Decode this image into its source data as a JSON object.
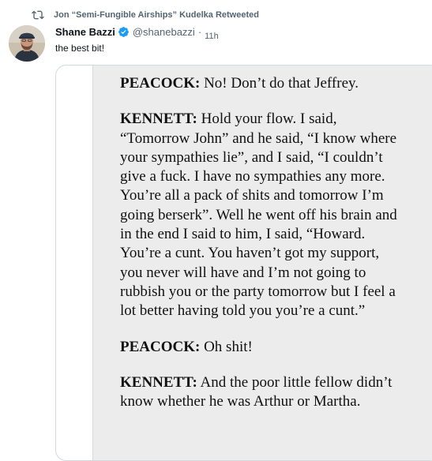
{
  "retweet": {
    "icon": "retweet-icon",
    "text": "Jon “Semi-Fungible Airships” Kudelka Retweeted"
  },
  "author": {
    "name": "Shane Bazzi",
    "verified_icon": "verified-badge-icon",
    "handle": "@shanebazzi",
    "separator": "·",
    "time": "11h"
  },
  "tweet": {
    "text": "the best bit!"
  },
  "colors": {
    "verified": "#1d9bf0",
    "secondary_text": "#536471",
    "page_bg": "#ececec"
  },
  "transcript": [
    {
      "speaker": "PEACOCK:",
      "text": " No! Don’t do that Jeffrey."
    },
    {
      "speaker": "KENNETT:",
      "text": " Hold your flow. I said, “Tomorrow John” and he said, “I know where your sympathies lie”, and I said, “I couldn’t give a fuck. I have no sympathies any more. You’re all a pack of shits and tomorrow I’m going berserk”. Well he went off his brain and in the end I said to him, I said, “Howard. You’re a cunt. You haven’t got my support, you never will have and I’m not going to rubbish you or the party tomorrow but I feel a lot better having told you you’re a cunt.”"
    },
    {
      "speaker": "PEACOCK:",
      "text": " Oh shit!"
    },
    {
      "speaker": "KENNETT:",
      "text": " And the poor little fellow didn’t know whether he was Arthur or Martha."
    }
  ]
}
